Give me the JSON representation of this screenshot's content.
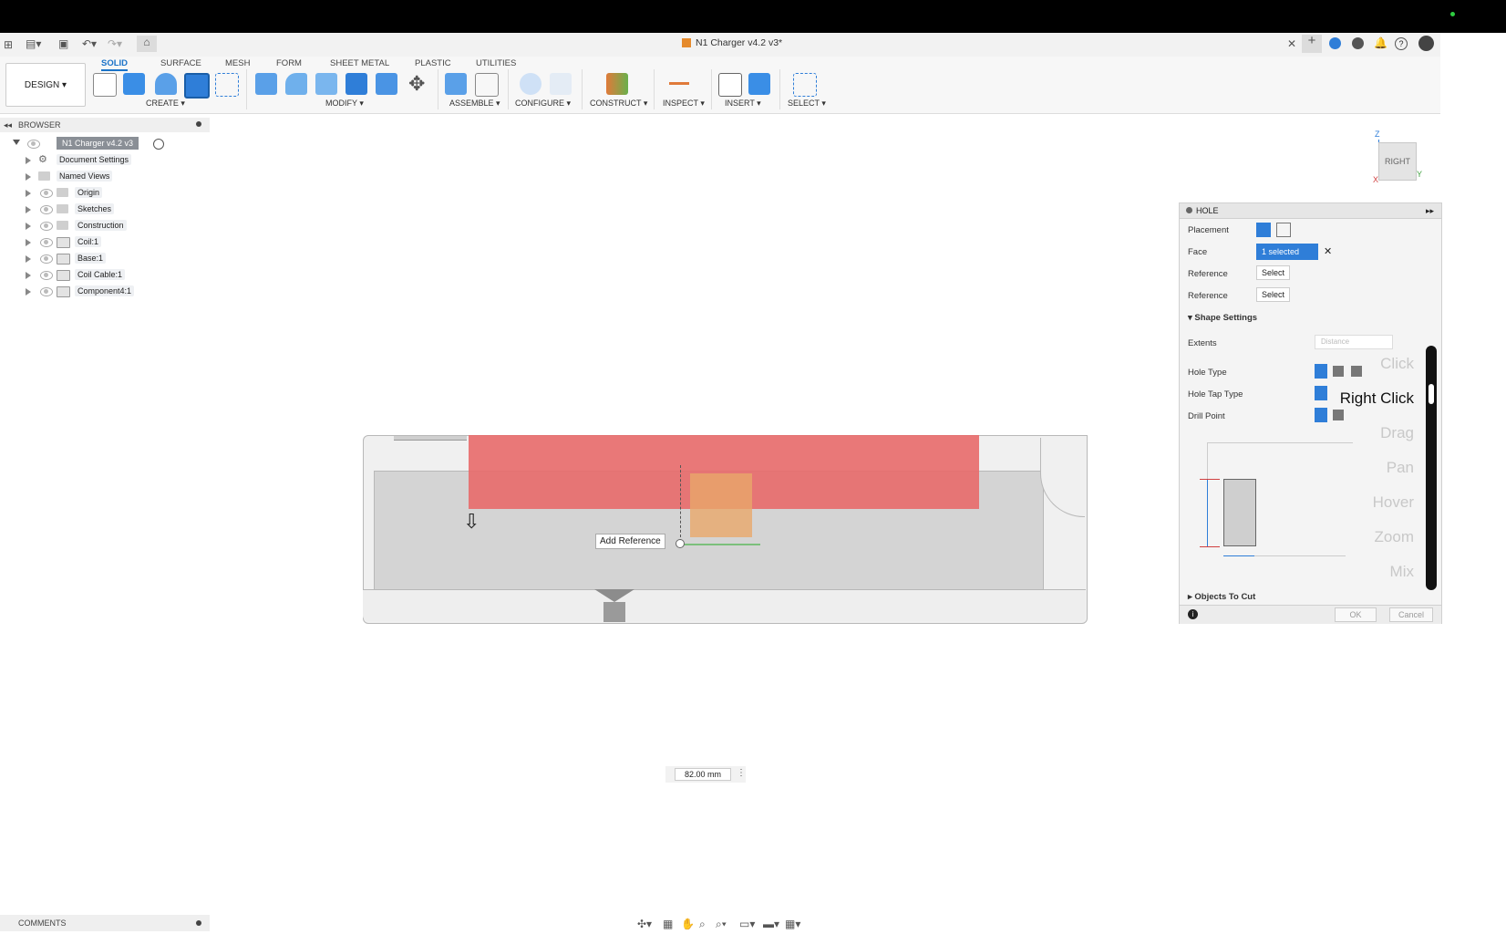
{
  "app": {
    "document_title": "N1 Charger v4.2 v3*"
  },
  "ribbon": {
    "tabs": [
      "SOLID",
      "SURFACE",
      "MESH",
      "FORM",
      "SHEET METAL",
      "PLASTIC",
      "UTILITIES"
    ],
    "design_button": "DESIGN ▾",
    "groups": [
      "CREATE ▾",
      "MODIFY ▾",
      "ASSEMBLE ▾",
      "CONFIGURE ▾",
      "CONSTRUCT ▾",
      "INSPECT ▾",
      "INSERT ▾",
      "SELECT ▾"
    ]
  },
  "browser": {
    "header": "BROWSER",
    "root": "N1 Charger v4.2 v3",
    "items": [
      "Document Settings",
      "Named Views",
      "Origin",
      "Sketches",
      "Construction",
      "Coil:1",
      "Base:1",
      "Coil Cable:1",
      "Component4:1"
    ]
  },
  "viewcube": {
    "face": "RIGHT",
    "axis_z": "Z",
    "axis_x": "X",
    "axis_y": "Y"
  },
  "canvas": {
    "tooltip": "Add Reference",
    "dimension_value": "82.00 mm"
  },
  "hole_panel": {
    "title": "HOLE",
    "placement_label": "Placement",
    "face_label": "Face",
    "face_value": "1 selected",
    "reference1_label": "Reference",
    "reference1_value": "Select",
    "reference2_label": "Reference",
    "reference2_value": "Select",
    "shape_settings": "Shape Settings",
    "extents_label": "Extents",
    "extents_value": "Distance",
    "hole_type_label": "Hole Type",
    "hole_tap_label": "Hole Tap Type",
    "drill_point_label": "Drill Point",
    "objects_to_cut": "Objects To Cut",
    "ok": "OK",
    "cancel": "Cancel"
  },
  "mouse_overlay": {
    "labels": [
      "Click",
      "Right Click",
      "Drag",
      "Pan",
      "Hover",
      "Zoom",
      "Mix"
    ],
    "active": "Right Click"
  },
  "comments": {
    "header": "COMMENTS"
  },
  "colors": {
    "accent": "#1a73c8",
    "selection_red": "#e86a6a",
    "selection_orange": "#e8a86a",
    "body_gray": "#d4d4d4"
  }
}
